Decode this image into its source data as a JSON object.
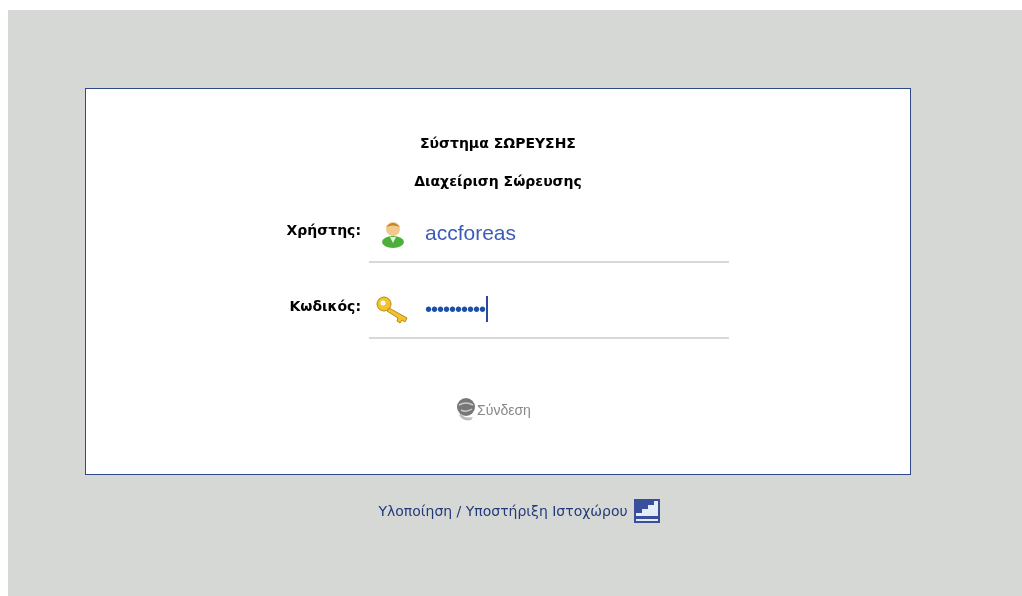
{
  "header": {
    "title": "Σύστημα ΣΩΡΕΥΣΗΣ",
    "subtitle": "Διαχείριση Σώρευσης"
  },
  "fields": [
    {
      "kind": "user",
      "label": "Χρήστης:",
      "value": "accforeas",
      "focused": false
    },
    {
      "kind": "password",
      "label": "Κωδικός:",
      "value": "••••••••••",
      "focused": true
    }
  ],
  "login_button": {
    "label": "Σύνδεση"
  },
  "footer": {
    "text": "Υλοποίηση / Υποστήριξη Ιστοχώρου"
  }
}
